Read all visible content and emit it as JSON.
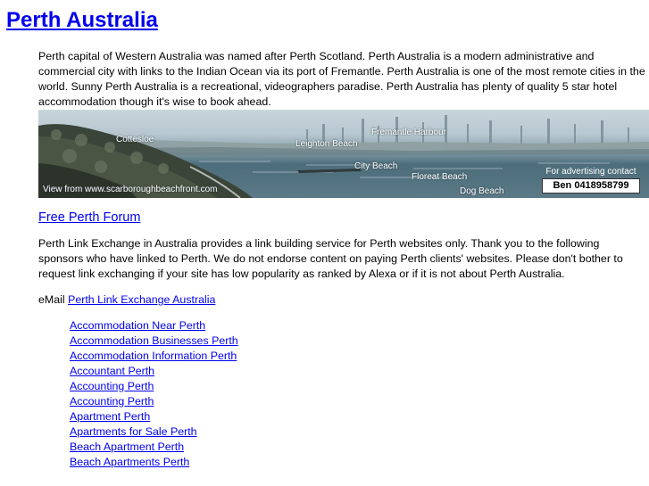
{
  "site": {
    "title": "Perth Australia"
  },
  "intro": {
    "text": "Perth capital of Western Australia was named after Perth Scotland. Perth Australia is a modern administrative and commercial city with links to the Indian Ocean via its port of Fremantle. Perth Australia is one of the most remote cities in the world. Sunny Perth Australia is a recreational, videographers paradise. Perth Australia has plenty of quality 5 star hotel accommodation though it's wise to book ahead."
  },
  "banner": {
    "labels": {
      "cottesloe": "Cottesloe",
      "leighton_beach": "Leighton Beach",
      "fremantle_harbour": "Fremantle Harbour",
      "city_beach": "City Beach",
      "floreat_beach": "Floreat Beach",
      "dog_beach": "Dog Beach"
    },
    "credit": "View from  www.scarboroughbeachfront.com",
    "ad_contact": "For advertising contact",
    "ad_phone": "Ben 0418958799",
    "colors": {
      "sky": "#c8d6dc",
      "sea": "#4d6d7b",
      "foreground": "#3a4438"
    }
  },
  "forum": {
    "label": "Free Perth Forum"
  },
  "exchange": {
    "text": "Perth Link Exchange in Australia provides a link building service for Perth websites only. Thank you to the following sponsors who have linked to Perth. We do not endorse content on paying Perth clients' websites. Please don't bother to request link exchanging if your site has low popularity as ranked by Alexa or if it is not about Perth Australia."
  },
  "email": {
    "prefix": "eMail ",
    "link_label": "Perth Link Exchange Australia"
  },
  "links": [
    "Accommodation Near Perth",
    "Accommodation Businesses Perth",
    "Accommodation Information Perth",
    "Accountant Perth",
    "Accounting Perth",
    "Accounting Perth",
    "Apartment Perth",
    "Apartments for Sale Perth",
    "Beach Apartment Perth",
    "Beach Apartments Perth"
  ],
  "theme": {
    "link_color": "#0000ee",
    "text_color": "#000000"
  }
}
